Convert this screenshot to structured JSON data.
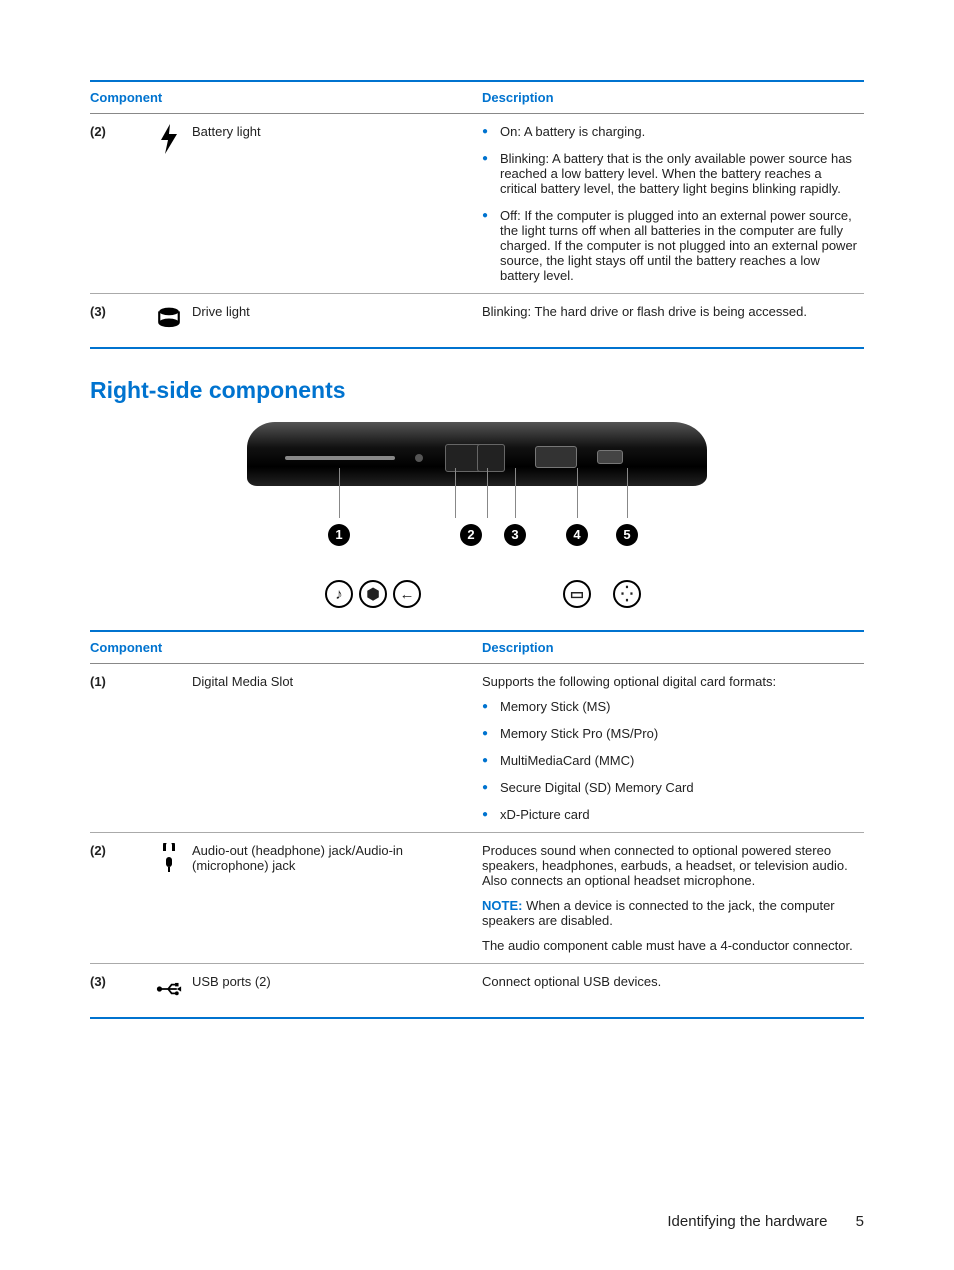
{
  "table1": {
    "headers": {
      "component": "Component",
      "description": "Description"
    },
    "rows": [
      {
        "num": "(2)",
        "icon": "battery-light-icon",
        "name": "Battery light",
        "desc_bullets": [
          "On: A battery is charging.",
          "Blinking: A battery that is the only available power source has reached a low battery level. When the battery reaches a critical battery level, the battery light begins blinking rapidly.",
          "Off: If the computer is plugged into an external power source, the light turns off when all batteries in the computer are fully charged. If the computer is not plugged into an external power source, the light stays off until the battery reaches a low battery level."
        ]
      },
      {
        "num": "(3)",
        "icon": "drive-light-icon",
        "name": "Drive light",
        "desc_text": "Blinking: The hard drive or flash drive is being accessed."
      }
    ]
  },
  "section_heading": "Right-side components",
  "callout_numbers": [
    "1",
    "2",
    "3",
    "4",
    "5"
  ],
  "table2": {
    "headers": {
      "component": "Component",
      "description": "Description"
    },
    "rows": [
      {
        "num": "(1)",
        "icon": "",
        "name": "Digital Media Slot",
        "desc_intro": "Supports the following optional digital card formats:",
        "desc_bullets": [
          "Memory Stick (MS)",
          "Memory Stick Pro (MS/Pro)",
          "MultiMediaCard (MMC)",
          "Secure Digital (SD) Memory Card",
          "xD-Picture card"
        ]
      },
      {
        "num": "(2)",
        "icon": "audio-jack-icon",
        "name": "Audio-out (headphone) jack/Audio-in (microphone) jack",
        "desc_text": "Produces sound when connected to optional powered stereo speakers, headphones, earbuds, a headset, or television audio. Also connects an optional headset microphone.",
        "note_label": "NOTE:",
        "note_text": " When a device is connected to the jack, the computer speakers are disabled.",
        "desc_text2": "The audio component cable must have a 4-conductor connector."
      },
      {
        "num": "(3)",
        "icon": "usb-icon",
        "name": "USB ports (2)",
        "desc_text": "Connect optional USB devices."
      }
    ]
  },
  "footer": {
    "text": "Identifying the hardware",
    "page": "5"
  }
}
